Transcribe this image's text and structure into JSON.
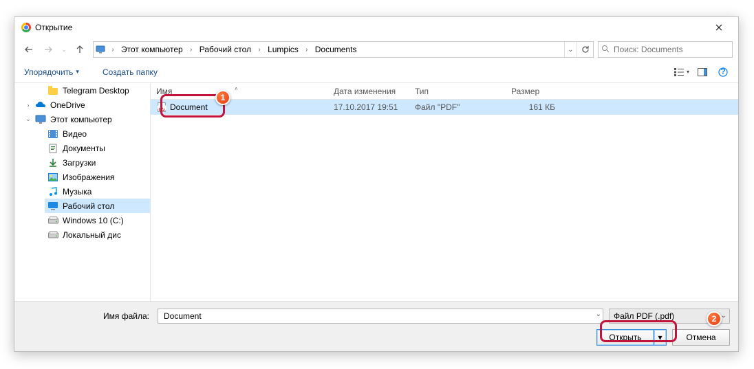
{
  "window": {
    "title": "Открытие"
  },
  "nav": {
    "breadcrumbs": [
      "Этот компьютер",
      "Рабочий стол",
      "Lumpics",
      "Documents"
    ],
    "search_placeholder": "Поиск: Documents"
  },
  "toolbar": {
    "organize": "Упорядочить",
    "newfolder": "Создать папку"
  },
  "sidebar": {
    "items": [
      {
        "label": "Telegram Desktop",
        "icon": "folder",
        "level": 2,
        "chev": ""
      },
      {
        "label": "OneDrive",
        "icon": "onedrive",
        "level": 1,
        "chev": "›"
      },
      {
        "label": "Этот компьютер",
        "icon": "thispc",
        "level": 1,
        "chev": "⌄"
      },
      {
        "label": "Видео",
        "icon": "video",
        "level": 2,
        "chev": ""
      },
      {
        "label": "Документы",
        "icon": "docs",
        "level": 2,
        "chev": ""
      },
      {
        "label": "Загрузки",
        "icon": "dl",
        "level": 2,
        "chev": ""
      },
      {
        "label": "Изображения",
        "icon": "img",
        "level": 2,
        "chev": ""
      },
      {
        "label": "Музыка",
        "icon": "music",
        "level": 2,
        "chev": ""
      },
      {
        "label": "Рабочий стол",
        "icon": "desktop",
        "level": 2,
        "chev": "",
        "selected": true
      },
      {
        "label": "Windows 10 (C:)",
        "icon": "drive",
        "level": 2,
        "chev": "›"
      },
      {
        "label": "Локальный дис",
        "icon": "drive",
        "level": 2,
        "chev": "›"
      }
    ]
  },
  "grid": {
    "columns": {
      "name": "Имя",
      "date": "Дата изменения",
      "type": "Тип",
      "size": "Размер"
    },
    "rows": [
      {
        "name": "Document",
        "date": "17.10.2017 19:51",
        "type": "Файл \"PDF\"",
        "size": "161 КБ",
        "selected": true
      }
    ]
  },
  "bottom": {
    "fname_label": "Имя файла:",
    "fname_value": "Document",
    "ftype_value": "Файл PDF (.pdf)",
    "open": "Открыть",
    "cancel": "Отмена"
  },
  "annotations": {
    "badge1": "1",
    "badge2": "2"
  }
}
